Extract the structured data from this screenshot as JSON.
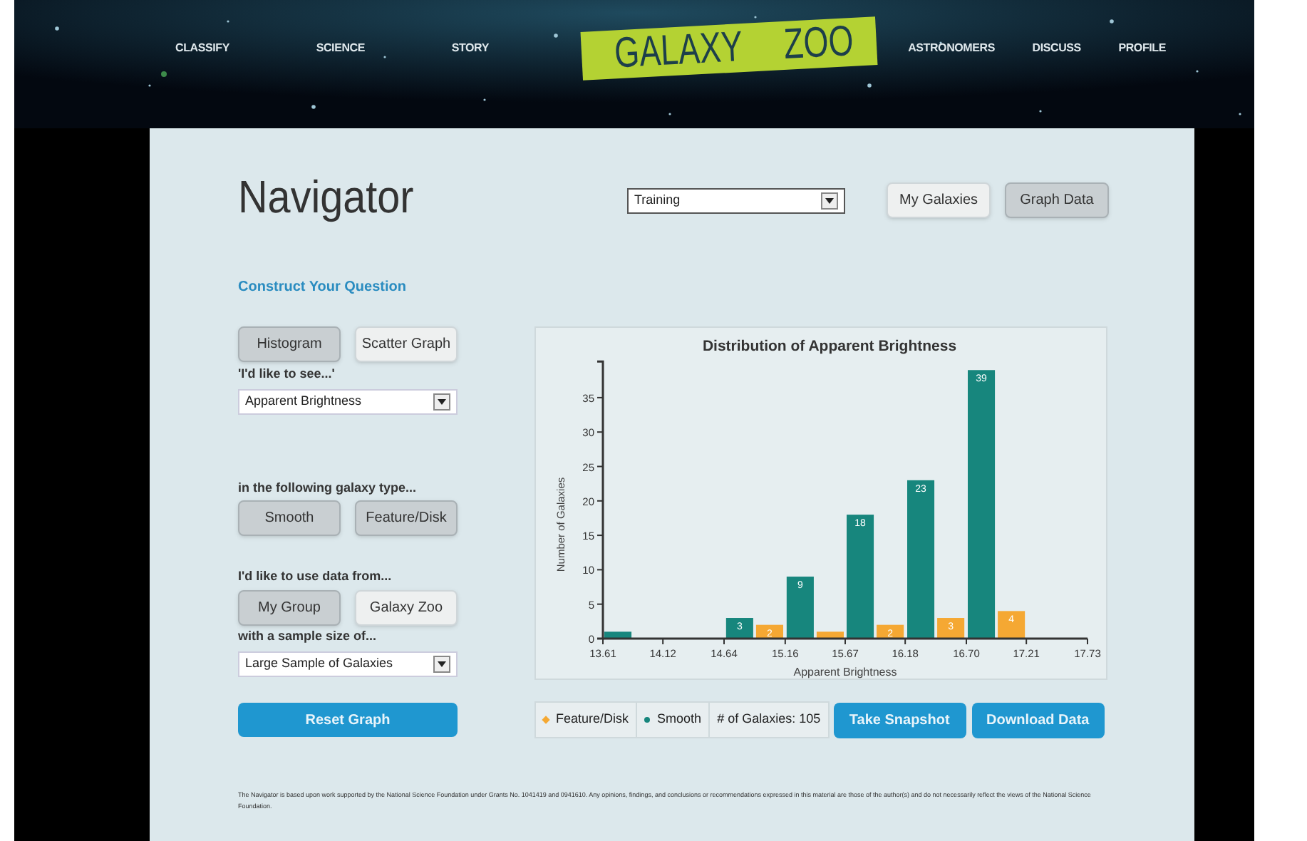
{
  "nav": {
    "left": [
      "CLASSIFY",
      "SCIENCE",
      "STORY"
    ],
    "logo": [
      "GALAXY",
      "ZOO"
    ],
    "right": [
      "ASTRONOMERS",
      "DISCUSS",
      "PROFILE"
    ]
  },
  "title": "Navigator",
  "view_select": {
    "value": "Training"
  },
  "top_buttons": [
    {
      "label": "My Galaxies",
      "selected": false
    },
    {
      "label": "Graph Data",
      "selected": true
    }
  ],
  "section_title": "Construct Your Question",
  "graph_types": [
    {
      "label": "Histogram",
      "selected": true
    },
    {
      "label": "Scatter Graph",
      "selected": false
    }
  ],
  "see_label": "'I'd like to see...'",
  "variable_select": {
    "value": "Apparent Brightness"
  },
  "type_label": "in the following galaxy type...",
  "galaxy_types": [
    {
      "label": "Smooth",
      "selected": true
    },
    {
      "label": "Feature/Disk",
      "selected": true
    }
  ],
  "source_label": "I'd like to use data from...",
  "sources": [
    {
      "label": "My Group",
      "selected": true
    },
    {
      "label": "Galaxy Zoo",
      "selected": false
    }
  ],
  "sample_label": "with a sample size of...",
  "sample_select": {
    "value": "Large Sample of Galaxies"
  },
  "reset_button": "Reset Graph",
  "chart_data": {
    "type": "bar",
    "title": "Distribution of Apparent Brightness",
    "xlabel": "Apparent Brightness",
    "ylabel": "Number of Galaxies",
    "x": [
      13.865,
      14.9,
      15.415,
      15.925,
      16.44,
      16.955
    ],
    "series": [
      {
        "name": "Feature/Disk",
        "color": "#f5a833",
        "values": [
          0,
          2,
          1,
          2,
          3,
          4
        ]
      },
      {
        "name": "Smooth",
        "color": "#17867d",
        "values": [
          1,
          3,
          9,
          18,
          23,
          39
        ]
      }
    ],
    "xlim": [
      13.61,
      17.73
    ],
    "xticks": [
      13.61,
      14.12,
      14.64,
      15.16,
      15.67,
      16.18,
      {
        "value": 16.7,
        "label": "16.70"
      },
      17.21,
      17.73
    ],
    "ylim": [
      0,
      39
    ],
    "yticks": [
      0,
      5,
      10,
      15,
      20,
      25,
      30,
      35
    ],
    "value_labels": [
      [
        null,
        "2",
        null,
        "2",
        "3",
        "4"
      ],
      [
        null,
        "3",
        "9",
        "18",
        "23",
        "39"
      ]
    ]
  },
  "legend": [
    {
      "kind": "diamond"
    },
    {
      "kind": "dot"
    }
  ],
  "count": "# of Galaxies: 105",
  "actions": [
    "Take Snapshot",
    "Download Data"
  ],
  "footer": "The Navigator is based upon work supported by the National Science Foundation under Grants No. 1041419 and 0941610. Any opinions, findings, and conclusions or recommendations expressed in this material are those of the author(s) and do not necessarily reflect the views of the National Science Foundation."
}
